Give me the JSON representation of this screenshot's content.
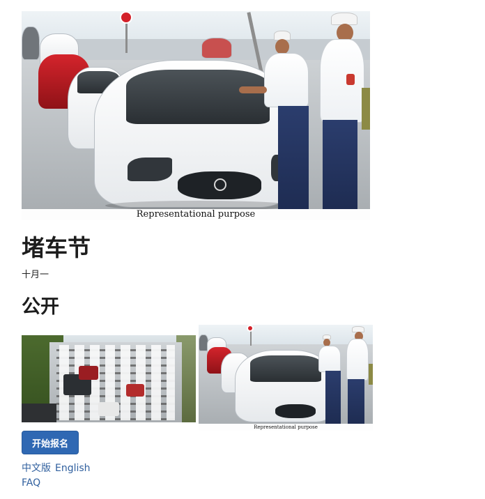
{
  "event": {
    "title": "堵车节",
    "date": "十月一",
    "visibility": "公开"
  },
  "images": {
    "hero_caption": "Representational purpose",
    "police_caption": "Representational purpose"
  },
  "actions": {
    "signup_label": "开始报名"
  },
  "footer": {
    "lang_chinese": "中文版",
    "lang_english": "English",
    "faq": "FAQ"
  },
  "colors": {
    "primary_button": "#2f68b3",
    "link": "#2f5f9e"
  }
}
